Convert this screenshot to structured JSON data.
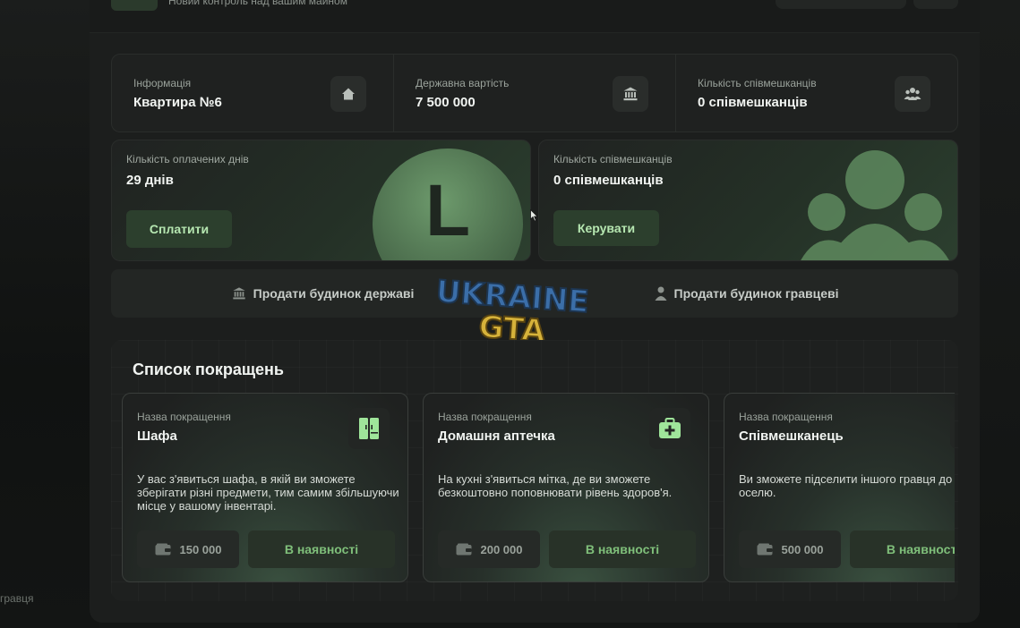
{
  "header": {
    "subtitle": "Новий контроль над вашим майном"
  },
  "info": [
    {
      "label": "Інформація",
      "value": "Квартира №6",
      "icon": "house-icon"
    },
    {
      "label": "Державна вартість",
      "value": "7 500 000",
      "icon": "bank-icon"
    },
    {
      "label": "Кількість співмешканців",
      "value": "0 співмешканців",
      "icon": "people-icon"
    }
  ],
  "days_card": {
    "label": "Кількість оплачених днів",
    "value": "29 днів",
    "button": "Сплатити",
    "emblem_letter": "L"
  },
  "tenants_card": {
    "label": "Кількість співмешканців",
    "value": "0 співмешканців",
    "button": "Керувати"
  },
  "sell": {
    "state_label": "Продати будинок державі",
    "player_label": "Продати будинок гравцеві"
  },
  "watermark": {
    "line1": "UKRAINE",
    "line2": "GTA"
  },
  "upgrades": {
    "title": "Список покращень",
    "items": [
      {
        "label": "Назва покращення",
        "name": "Шафа",
        "description": "У вас з'явиться шафа, в якій ви зможете зберігати різні предмети, тим самим збільшуючи місце у вашому інвентарі.",
        "price": "150 000",
        "status": "В наявності",
        "icon": "wardrobe-icon"
      },
      {
        "label": "Назва покращення",
        "name": "Домашня аптечка",
        "description": "На кухні з'явиться мітка, де ви зможете безкоштовно поповнювати рівень здоров'я.",
        "price": "200 000",
        "status": "В наявності",
        "icon": "medkit-icon"
      },
      {
        "label": "Назва покращення",
        "name": "Співмешканець",
        "description": "Ви зможете підселити іншого гравця до себе в оселю.",
        "price": "500 000",
        "status": "В наявності",
        "icon": "roommate-icon"
      }
    ]
  },
  "background_caption": "гравця",
  "colors": {
    "accent_green": "#7fbf7a",
    "button_bg": "#2c3f2d",
    "panel_bg": "#1c1e1d"
  }
}
